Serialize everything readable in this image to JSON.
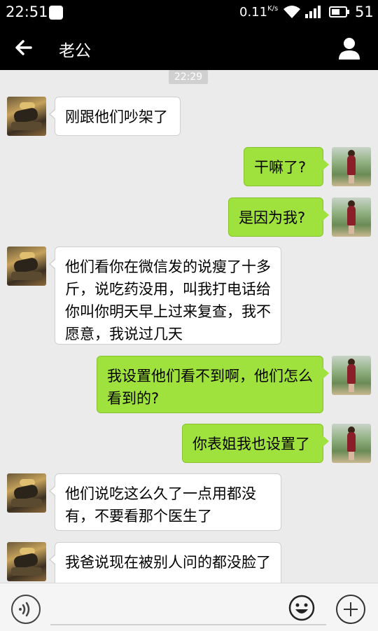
{
  "status_bar": {
    "time": "22:51",
    "net_speed": "0.11",
    "net_speed_unit": "K/s",
    "battery_level": "51",
    "notification_icon": "notification-icon",
    "wifi_icon": "wifi-icon",
    "signal_icon": "signal-icon",
    "battery_icon": "battery-icon"
  },
  "header": {
    "back_icon": "back-arrow-icon",
    "title": "老公",
    "profile_icon": "profile-icon"
  },
  "chat": {
    "timestamp": "22:29",
    "messages": [
      {
        "side": "in",
        "text": "刚跟他们吵架了"
      },
      {
        "side": "out",
        "text": "干嘛了?"
      },
      {
        "side": "out",
        "text": "是因为我?"
      },
      {
        "side": "in",
        "text": "他们看你在微信发的说瘦了十多斤，说吃药没用，叫我打电话给你叫你明天早上过来复查，我不愿意，我说过几天"
      },
      {
        "side": "out",
        "text": "我设置他们看不到啊，他们怎么看到的?"
      },
      {
        "side": "out",
        "text": "你表姐我也设置了"
      },
      {
        "side": "in",
        "text": "他们说吃这么久了一点用都没有，不要看那个医生了"
      },
      {
        "side": "in",
        "text": "我爸说现在被别人问的都没脸了"
      }
    ]
  },
  "input_bar": {
    "voice_icon": "voice-icon",
    "emoji_icon": "emoji-icon",
    "plus_icon": "plus-icon",
    "text_value": ""
  },
  "colors": {
    "outgoing_bubble": "#9fe23e",
    "incoming_bubble": "#ffffff",
    "background": "#ebebeb",
    "header": "#000000"
  }
}
